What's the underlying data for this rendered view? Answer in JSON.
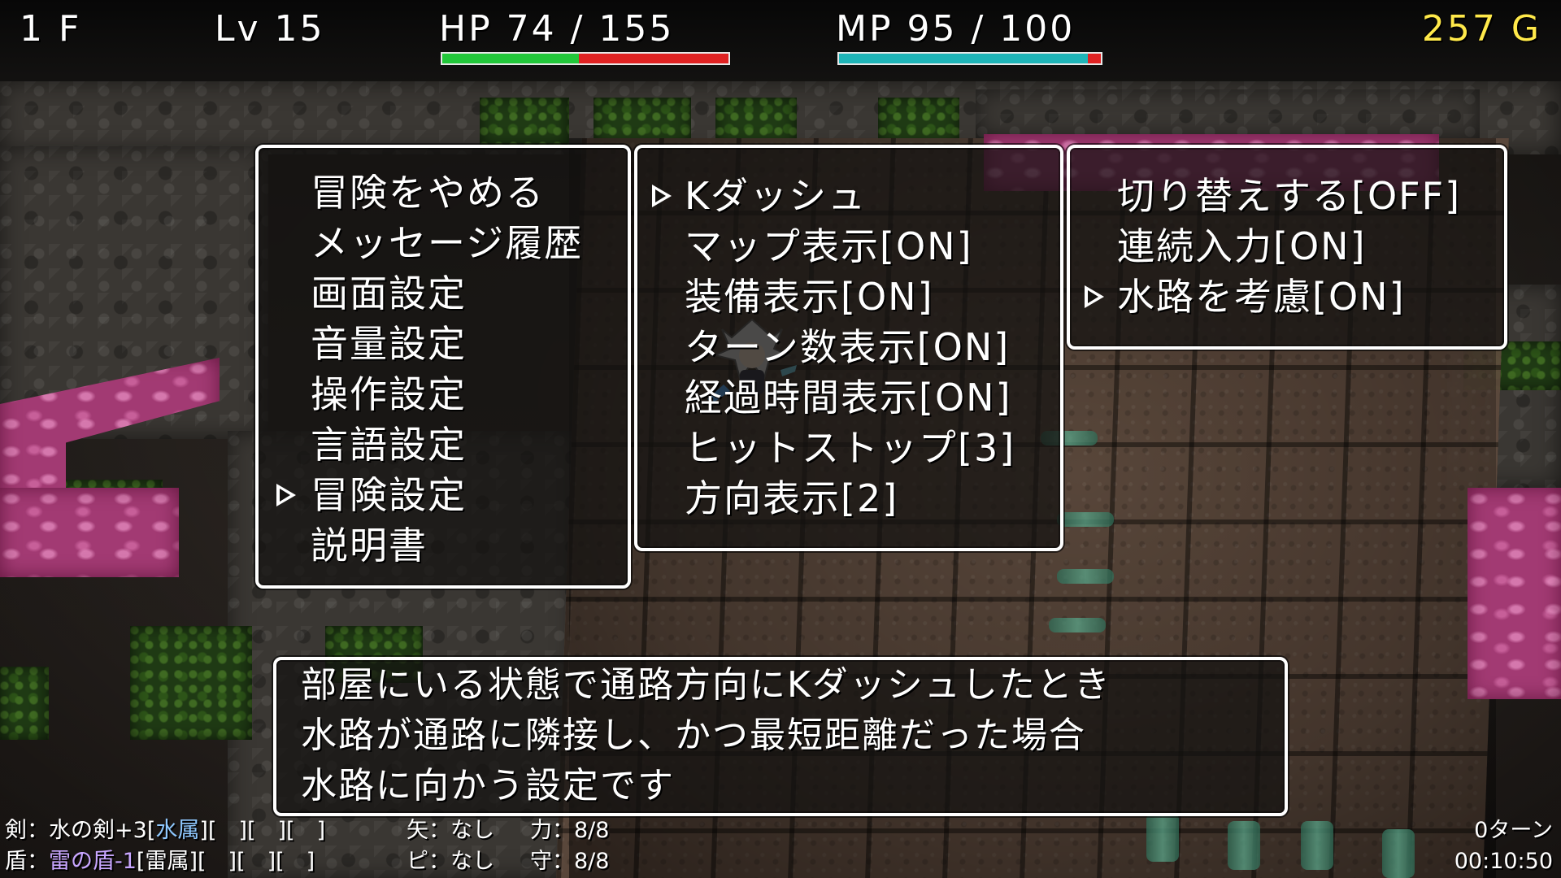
{
  "hud": {
    "floor": "1 F",
    "level": "Lv 15",
    "hp_text": "HP 74 / 155",
    "hp_fraction": 0.477,
    "mp_text": "MP 95 / 100",
    "mp_fraction": 0.95,
    "gold": "257 G"
  },
  "main_menu": {
    "items": [
      "冒険をやめる",
      "メッセージ履歴",
      "画面設定",
      "音量設定",
      "操作設定",
      "言語設定",
      "冒険設定",
      "説明書"
    ],
    "selected_index": 6
  },
  "adventure_menu": {
    "items": [
      "Kダッシュ",
      "マップ表示[ON]",
      "装備表示[ON]",
      "ターン数表示[ON]",
      "経過時間表示[ON]",
      "ヒットストップ[3]",
      "方向表示[2]"
    ],
    "selected_index": 0
  },
  "kdash_menu": {
    "items": [
      "切り替えする[OFF]",
      "連続入力[ON]",
      "水路を考慮[ON]"
    ],
    "selected_index": 2
  },
  "description": {
    "lines": [
      "部屋にいる状態で通路方向にKダッシュしたとき",
      "水路が通路に隣接し、かつ最短距離だった場合",
      "水路に向かう設定です"
    ]
  },
  "equipment": {
    "sword_prefix": "剣：",
    "sword_name": "水の剣+3",
    "sword_attr_open": "[",
    "sword_attr": "水属",
    "sword_attr_close": "]",
    "sword_slots": "[　][　][　]",
    "arrow": "矢：なし",
    "power": "力：8/8",
    "shield_prefix": "盾：",
    "shield_name": "雷の盾-1",
    "shield_attr": "[雷属]",
    "shield_slots": "[　][　][　]",
    "pi": "ピ：なし",
    "defense": "守：8/8"
  },
  "counters": {
    "turns": "0ターン",
    "elapsed": "00:10:50"
  },
  "colors": {
    "hp_green": "#22c83a",
    "hp_red": "#e02222",
    "mp_cyan": "#1fb5b8",
    "gold": "#ffe94a",
    "water_pink": "#a23a73"
  }
}
